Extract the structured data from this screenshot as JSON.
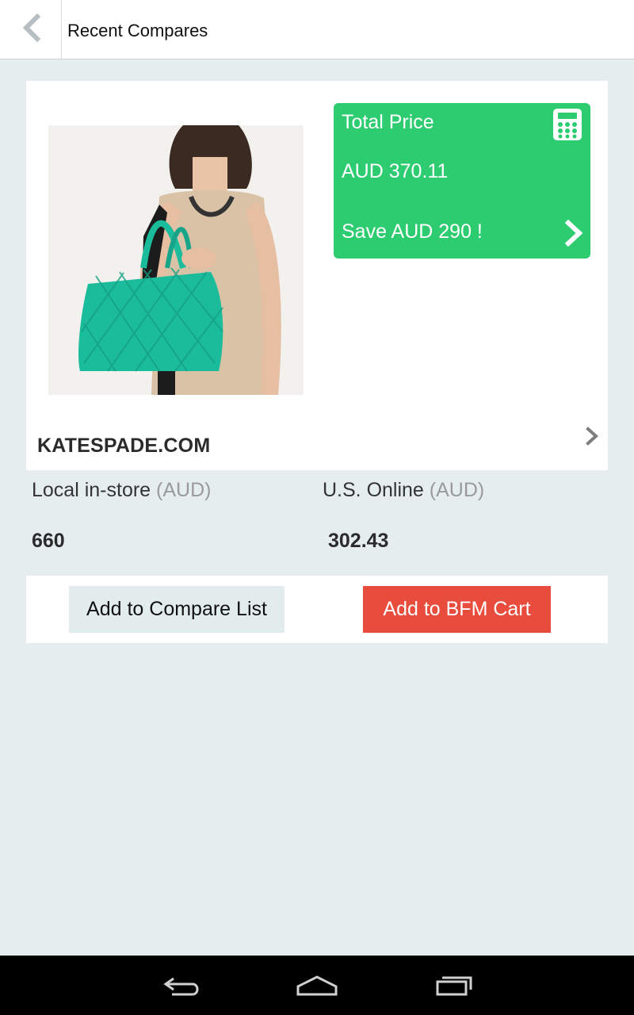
{
  "app_bar": {
    "title": "Recent Compares",
    "back_icon": "chevron-left-icon"
  },
  "product": {
    "image_icon": "product-photo",
    "store": "KATESPADE.COM",
    "total_panel": {
      "label": "Total Price",
      "value": "AUD 370.11",
      "save": "Save AUD 290 !",
      "icon": "calculator-icon"
    }
  },
  "prices": {
    "local": {
      "label": "Local in-store",
      "unit": "(AUD)",
      "value": "660"
    },
    "online": {
      "label": "U.S. Online",
      "unit": "(AUD)",
      "value": "302.43"
    }
  },
  "actions": {
    "compare_label": "Add to Compare List",
    "cart_label": "Add to BFM Cart"
  },
  "colors": {
    "accent_green": "#2ecc71",
    "cart_red": "#e74c3c",
    "background": "#e5edee"
  },
  "nav": {
    "back_icon": "nav-back-icon",
    "home_icon": "nav-home-icon",
    "recents_icon": "nav-recents-icon"
  }
}
